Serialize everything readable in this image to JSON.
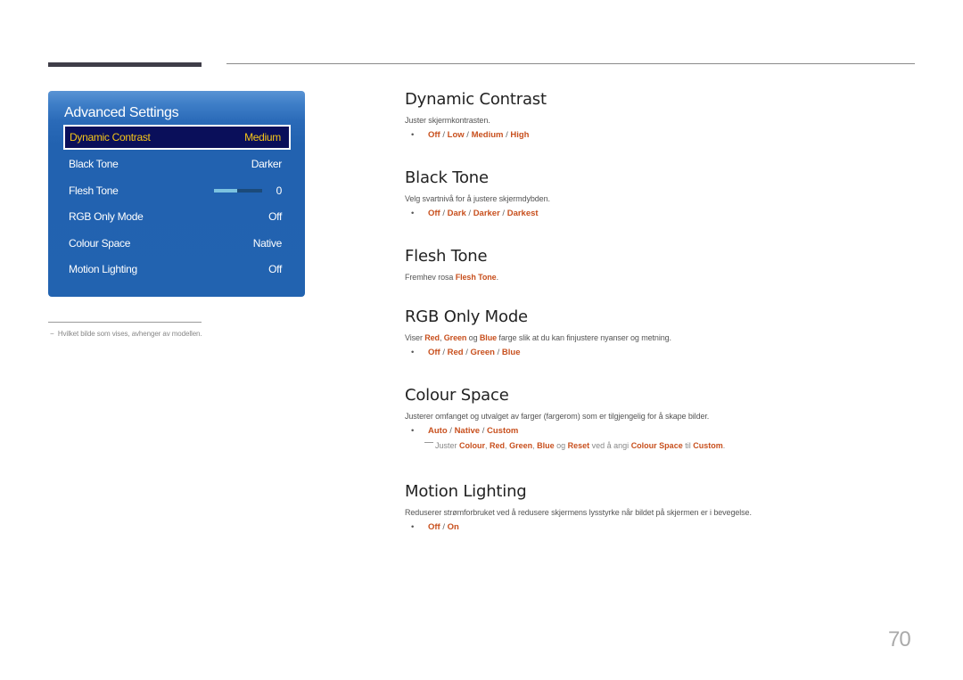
{
  "panel": {
    "title": "Advanced Settings",
    "items": [
      {
        "label": "Dynamic Contrast",
        "value": "Medium",
        "selected": true
      },
      {
        "label": "Black Tone",
        "value": "Darker"
      },
      {
        "label": "Flesh Tone",
        "value": "0",
        "slider_fraction": 0.48
      },
      {
        "label": "RGB Only Mode",
        "value": "Off"
      },
      {
        "label": "Colour Space",
        "value": "Native"
      },
      {
        "label": "Motion Lighting",
        "value": "Off"
      }
    ]
  },
  "footnote": "Hvilket bilde som vises, avhenger av modellen.",
  "footnote_dash": "−",
  "sections": {
    "dynamic_contrast": {
      "title": "Dynamic Contrast",
      "desc": "Juster skjermkontrasten.",
      "options": [
        "Off",
        "Low",
        "Medium",
        "High"
      ]
    },
    "black_tone": {
      "title": "Black Tone",
      "desc": "Velg svartnivå for å justere skjermdybden.",
      "options": [
        "Off",
        "Dark",
        "Darker",
        "Darkest"
      ]
    },
    "flesh_tone": {
      "title": "Flesh Tone",
      "desc_pre": "Fremhev rosa ",
      "desc_hl": "Flesh Tone",
      "desc_post": "."
    },
    "rgb_only_mode": {
      "title": "RGB Only Mode",
      "desc_parts": [
        "Viser ",
        "Red",
        ", ",
        "Green",
        " og ",
        "Blue",
        " farge slik at du kan finjustere nyanser og metning."
      ],
      "options": [
        "Off",
        "Red",
        "Green",
        "Blue"
      ]
    },
    "colour_space": {
      "title": "Colour Space",
      "desc": "Justerer omfanget og utvalget av farger (fargerom) som er tilgjengelig for å skape bilder.",
      "options": [
        "Auto",
        "Native",
        "Custom"
      ],
      "note_parts": [
        "Juster ",
        "Colour",
        ", ",
        "Red",
        ", ",
        "Green",
        ", ",
        "Blue",
        " og ",
        "Reset",
        " ved å angi ",
        "Colour Space",
        " til ",
        "Custom",
        "."
      ]
    },
    "motion_lighting": {
      "title": "Motion Lighting",
      "desc": "Reduserer strømforbruket ved å redusere skjermens lysstyrke når bildet på skjermen er i bevegelse.",
      "options": [
        "Off",
        "On"
      ]
    }
  },
  "bullet": "•",
  "option_separator": " / ",
  "page_number": "70",
  "colors": {
    "highlight": "#c8501e",
    "panel_blue": "#2263b0",
    "selected_bg": "#0a0f5a",
    "selected_text": "#f5c518"
  }
}
